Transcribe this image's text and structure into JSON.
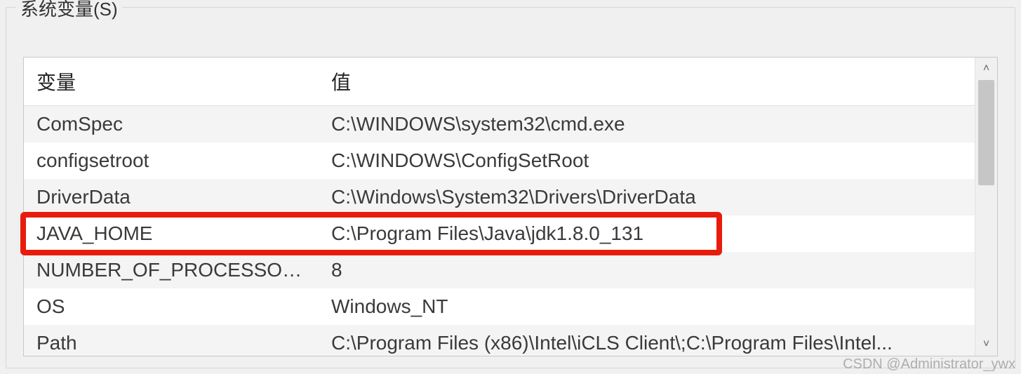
{
  "group": {
    "title": "系统变量(S)"
  },
  "table": {
    "headers": {
      "variable": "变量",
      "value": "值"
    },
    "rows": [
      {
        "variable": "ComSpec",
        "value": "C:\\WINDOWS\\system32\\cmd.exe",
        "highlighted": false
      },
      {
        "variable": "configsetroot",
        "value": "C:\\WINDOWS\\ConfigSetRoot",
        "highlighted": false
      },
      {
        "variable": "DriverData",
        "value": "C:\\Windows\\System32\\Drivers\\DriverData",
        "highlighted": false
      },
      {
        "variable": "JAVA_HOME",
        "value": "C:\\Program Files\\Java\\jdk1.8.0_131",
        "highlighted": true
      },
      {
        "variable": "NUMBER_OF_PROCESSORS",
        "value": "8",
        "highlighted": false
      },
      {
        "variable": "OS",
        "value": "Windows_NT",
        "highlighted": false
      },
      {
        "variable": "Path",
        "value": "C:\\Program Files (x86)\\Intel\\iCLS Client\\;C:\\Program Files\\Intel...",
        "highlighted": false
      }
    ]
  },
  "scrollbar": {
    "up_glyph": "˄",
    "down_glyph": "˅"
  },
  "watermark": "CSDN @Administrator_ywx"
}
